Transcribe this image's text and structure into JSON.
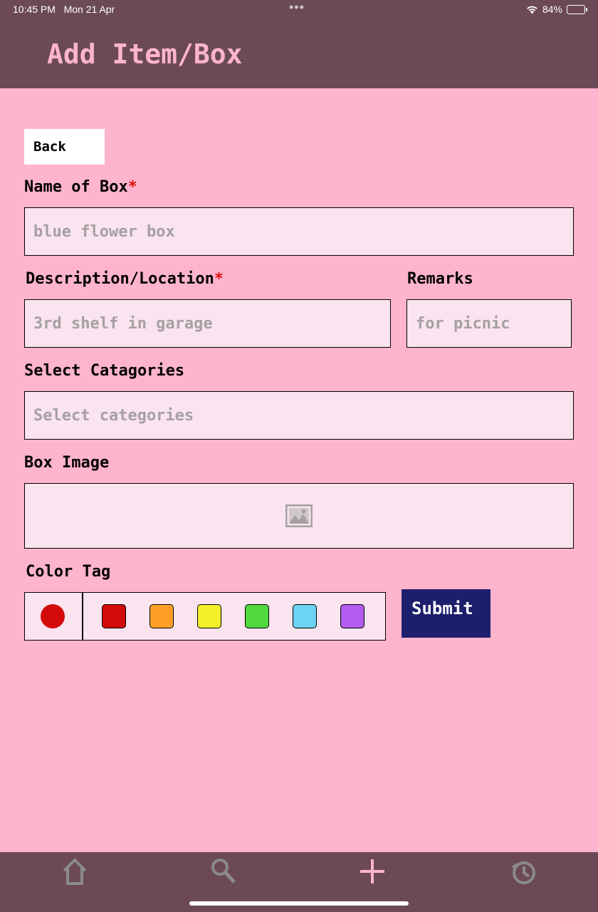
{
  "status_bar": {
    "time": "10:45 PM",
    "date": "Mon 21 Apr",
    "dots": "•••",
    "battery": "84%",
    "battery_level": 0.84
  },
  "header": {
    "title": "Add Item/Box"
  },
  "back_button": {
    "label": "Back"
  },
  "form": {
    "name": {
      "label": "Name of Box",
      "required_mark": "*",
      "placeholder": "blue flower box"
    },
    "description": {
      "label": "Description/Location",
      "required_mark": "*",
      "placeholder": "3rd shelf in garage"
    },
    "remarks": {
      "label": "Remarks",
      "placeholder": "for picnic"
    },
    "categories": {
      "label": "Select Catagories",
      "placeholder": "Select categories"
    },
    "box_image": {
      "label": "Box Image",
      "icon": "image-placeholder-icon"
    },
    "color_tag": {
      "label": "Color Tag",
      "selected_color": "#d30a0a",
      "swatches": [
        "#d30a0a",
        "#ff9f2a",
        "#f4f02a",
        "#4fd93c",
        "#6dd3f4",
        "#b25bf0"
      ]
    },
    "submit_label": "Submit"
  },
  "bottom_nav": {
    "items": [
      "home-icon",
      "search-icon",
      "add-icon",
      "history-icon"
    ],
    "icon_color": "#8c8a8b",
    "active_color": "#ffb4cd"
  },
  "colors": {
    "background": "#ffb4cd",
    "bar": "#6b4a55",
    "field": "#f9e4ef",
    "submit": "#1c1f6b"
  }
}
